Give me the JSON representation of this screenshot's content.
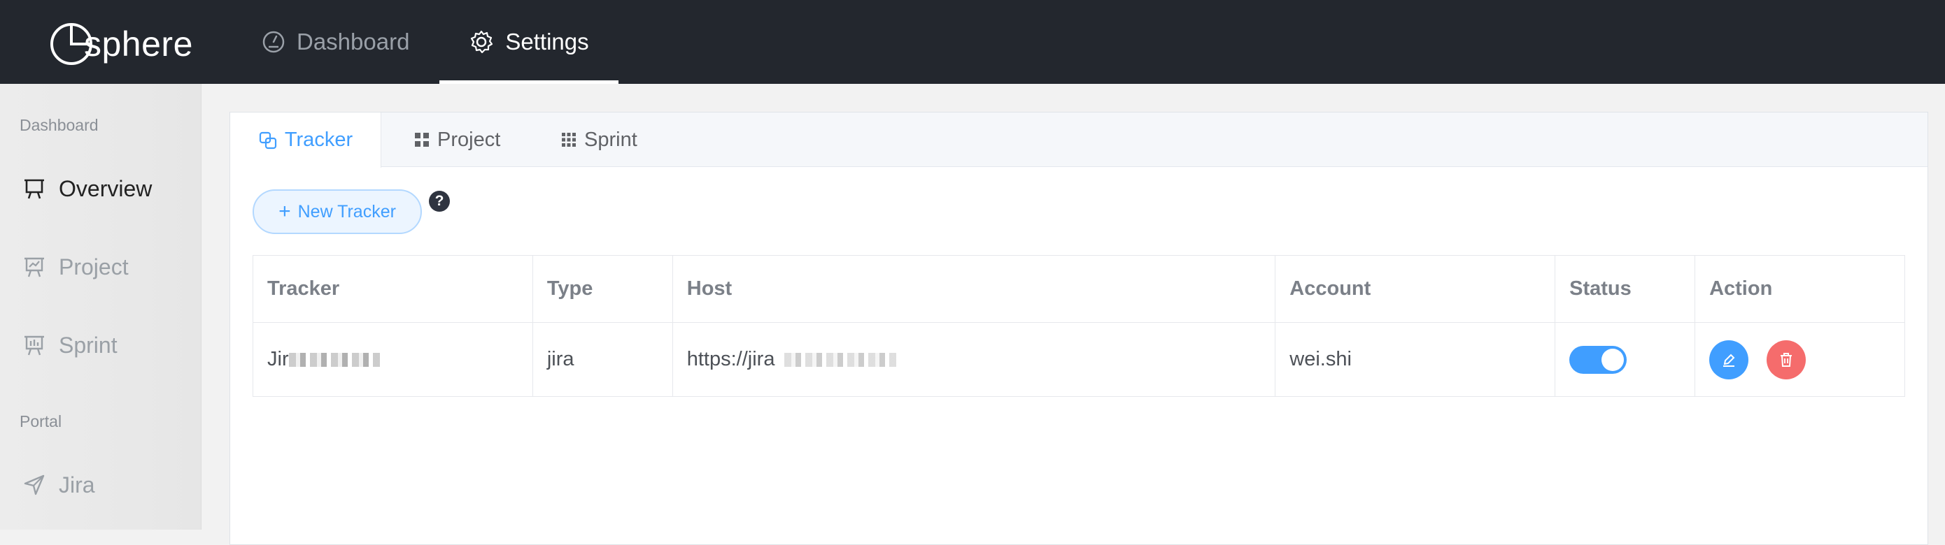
{
  "app": {
    "logo_text": "sphere"
  },
  "topnav": {
    "dashboard": {
      "label": "Dashboard",
      "icon": "gauge-icon"
    },
    "settings": {
      "label": "Settings",
      "icon": "gear-icon",
      "active": true
    }
  },
  "sidebar": {
    "groups": [
      {
        "label": "Dashboard",
        "items": [
          {
            "label": "Overview",
            "icon": "presentation-icon",
            "active": true
          },
          {
            "label": "Project",
            "icon": "chart-board-icon"
          },
          {
            "label": "Sprint",
            "icon": "board-icon"
          }
        ]
      },
      {
        "label": "Portal",
        "items": [
          {
            "label": "Jira",
            "icon": "send-icon"
          }
        ]
      }
    ]
  },
  "tabs": [
    {
      "label": "Tracker",
      "icon": "link-squares-icon",
      "active": true
    },
    {
      "label": "Project",
      "icon": "grid-icon"
    },
    {
      "label": "Sprint",
      "icon": "dots-grid-icon"
    }
  ],
  "toolbar": {
    "new_label": "New Tracker",
    "plus": "+",
    "help": "?"
  },
  "table": {
    "headers": [
      "Tracker",
      "Type",
      "Host",
      "Account",
      "Status",
      "Action"
    ],
    "rows": [
      {
        "tracker": "Jir",
        "type": "jira",
        "host": "https://jira",
        "account": "wei.shi",
        "status_enabled": true
      }
    ]
  },
  "colors": {
    "accent": "#409eff",
    "danger": "#f56c6c",
    "topbar": "#23272e"
  }
}
